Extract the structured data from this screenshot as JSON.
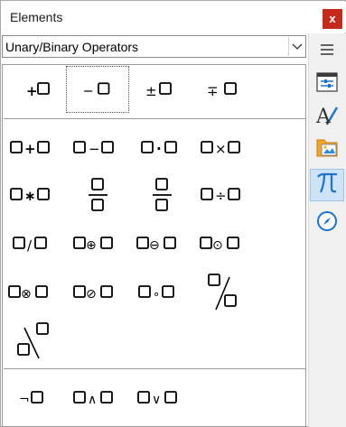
{
  "window": {
    "title": "Elements",
    "close_label": "x"
  },
  "category_select": {
    "value": "Unary/Binary Operators"
  },
  "sidebar": {
    "items": [
      {
        "name": "menu-icon",
        "active": false
      },
      {
        "name": "properties-icon",
        "active": false
      },
      {
        "name": "styles-icon",
        "active": false
      },
      {
        "name": "gallery-icon",
        "active": false
      },
      {
        "name": "math-elements-icon",
        "active": true
      },
      {
        "name": "navigator-icon",
        "active": false
      }
    ]
  },
  "elements": {
    "unary": [
      "+",
      "−",
      "±",
      "∓"
    ],
    "binary_row1": [
      "+",
      "−",
      "·",
      "×"
    ],
    "binary_row2_sym": [
      "∗",
      "÷"
    ],
    "binary_row3": [
      "/",
      "⊕",
      "⊖",
      "⊙"
    ],
    "binary_row4": [
      "⊗",
      "⊘",
      "∘"
    ],
    "logic": [
      "¬",
      "∧",
      "∨"
    ]
  }
}
